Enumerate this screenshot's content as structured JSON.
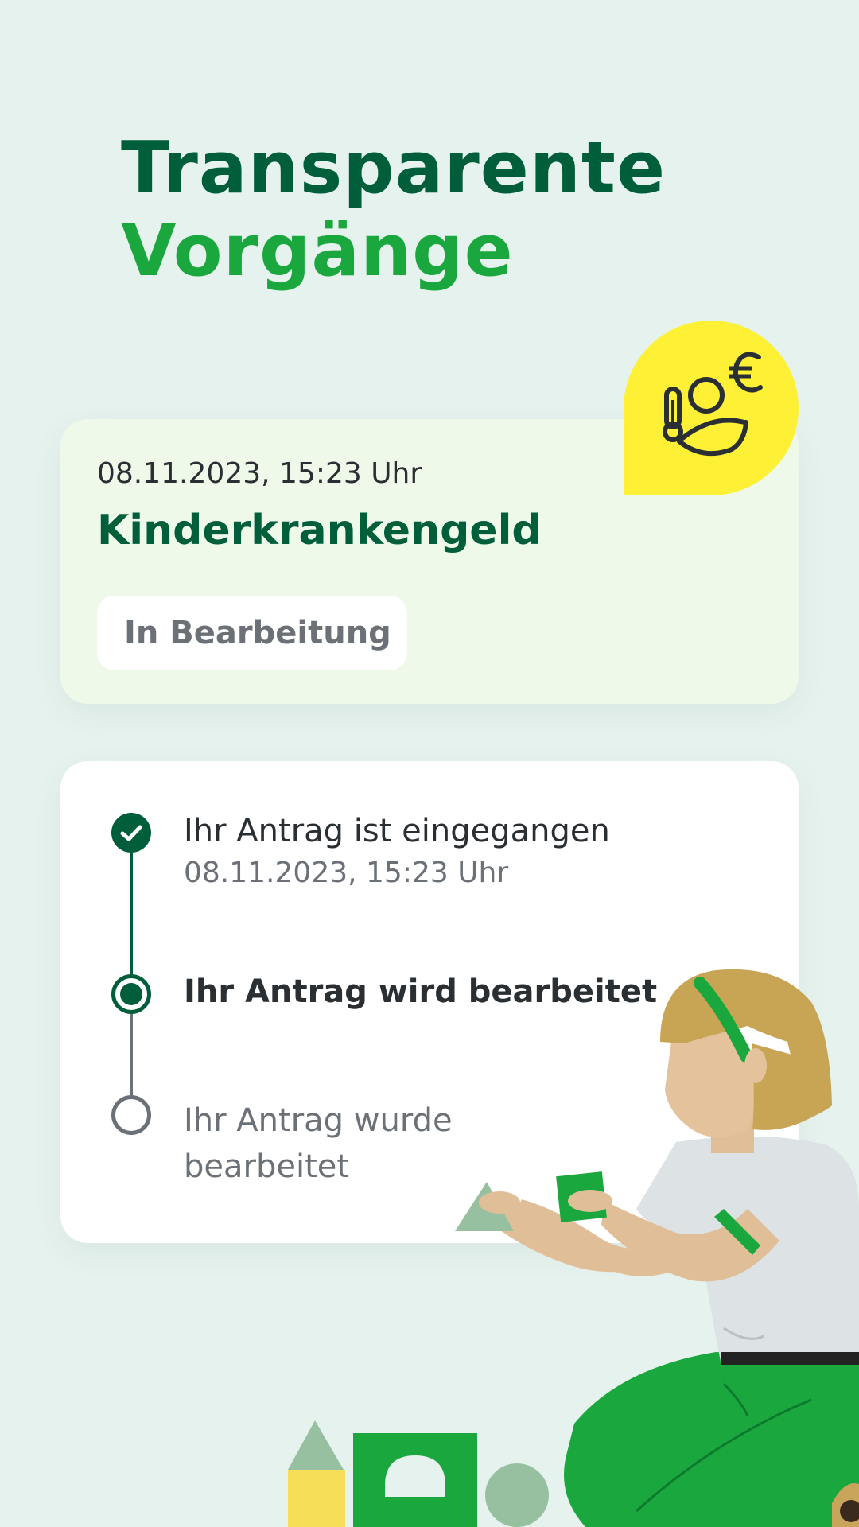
{
  "headline": {
    "line1": "Transparente",
    "line2": "Vorgänge"
  },
  "status_card": {
    "date": "08.11.2023, 15:23 Uhr",
    "title": "Kinderkrankengeld",
    "badge": "In Bearbeitung",
    "icon": "sick-pay-icon"
  },
  "timeline": {
    "steps": [
      {
        "title": "Ihr Antrag ist eingegangen",
        "date": "08.11.2023, 15:23 Uhr",
        "state": "done"
      },
      {
        "title": "Ihr Antrag wird bearbeitet",
        "state": "active"
      },
      {
        "title": "Ihr Antrag wurde bearbeitet",
        "state": "pending"
      }
    ]
  },
  "colors": {
    "background": "#e6f2ee",
    "primary_dark": "#005e3a",
    "primary_green": "#1aa83e",
    "accent_yellow": "#fdf035",
    "muted": "#6b7177"
  }
}
